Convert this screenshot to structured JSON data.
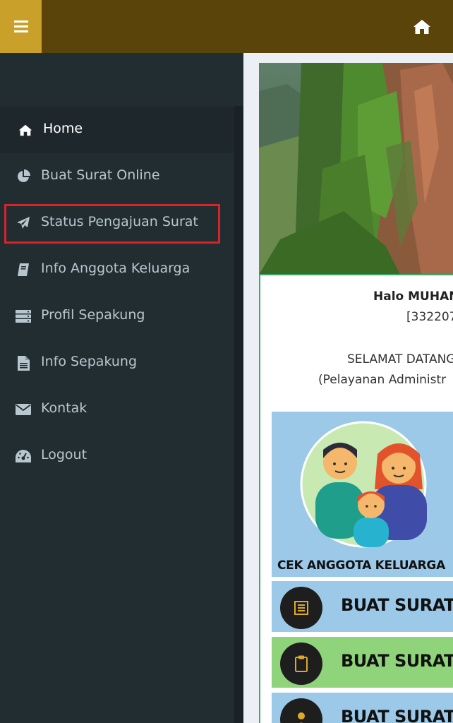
{
  "topbar": {
    "menu_icon": "hamburger-menu-icon",
    "home_icon": "home-icon",
    "background": "#5a4409",
    "menu_background": "#c9a02a"
  },
  "sidebar": {
    "background": "#222d32",
    "items": [
      {
        "label": "Home",
        "icon": "home-icon",
        "active": true
      },
      {
        "label": "Buat Surat Online",
        "icon": "pie-chart-icon",
        "active": false
      },
      {
        "label": "Status Pengajuan Surat",
        "icon": "paper-plane-icon",
        "active": false,
        "highlighted": true
      },
      {
        "label": "Info Anggota Keluarga",
        "icon": "book-icon",
        "active": false
      },
      {
        "label": "Profil Sepakung",
        "icon": "server-icon",
        "active": false
      },
      {
        "label": "Info Sepakung",
        "icon": "file-text-icon",
        "active": false
      },
      {
        "label": "Kontak",
        "icon": "envelope-icon",
        "active": false
      },
      {
        "label": "Logout",
        "icon": "dashboard-gauge-icon",
        "active": false
      }
    ],
    "highlight_color": "#d8232a"
  },
  "main": {
    "greeting": "Halo MUHAN",
    "nik": "[332207",
    "welcome": "SELAMAT DATANG",
    "subtitle": "(Pelayanan Administr",
    "family_banner": {
      "caption": "CEK ANGGOTA KELUARGA"
    },
    "actions": [
      {
        "label": "BUAT SURAT",
        "icon": "document-list-icon",
        "background": "#9cc9e8"
      },
      {
        "label": "BUAT SURAT",
        "icon": "clipboard-icon",
        "background": "#8fd37a"
      },
      {
        "label": "BUAT SURAT",
        "icon": "user-icon",
        "background": "#9cc9e8"
      }
    ],
    "card_border": "#3fa76b"
  }
}
